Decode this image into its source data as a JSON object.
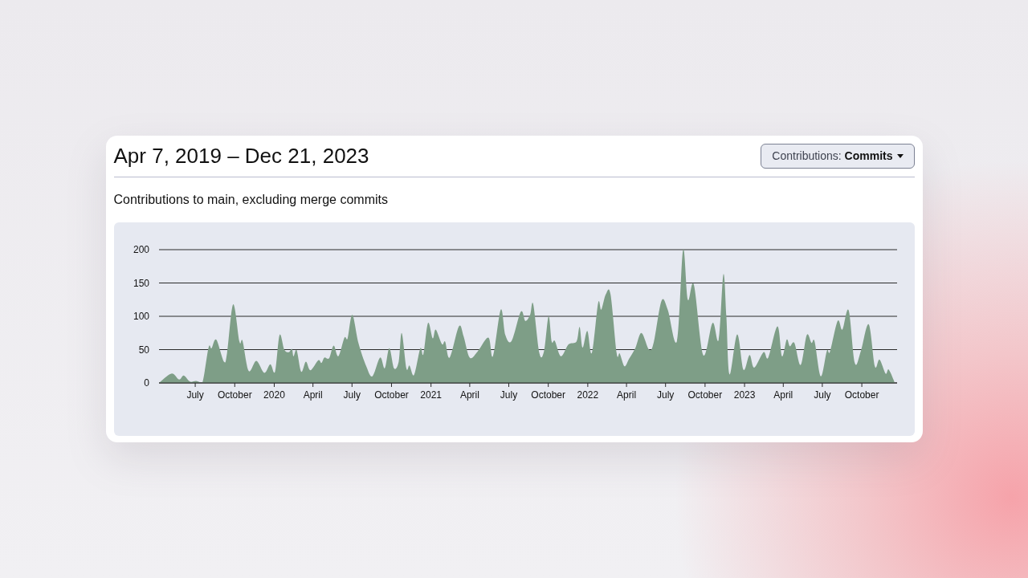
{
  "card": {
    "title": "Apr 7, 2019 – Dec 21, 2023",
    "menu_button": {
      "label": "Contributions: **Commits**"
    },
    "subtitle": "Contributions to main, excluding merge commits",
    "chart_data": {
      "type": "area",
      "grid": true,
      "xlim": [
        2019.265,
        2023.973
      ],
      "ylim": [
        0,
        200
      ],
      "yticks": [
        0,
        50,
        100,
        150,
        200
      ],
      "xticks": [
        {
          "value": 2019.496,
          "label": "July"
        },
        {
          "value": 2019.748,
          "label": "October"
        },
        {
          "value": 2020,
          "label": "2020"
        },
        {
          "value": 2020.247,
          "label": "April"
        },
        {
          "value": 2020.496,
          "label": "July"
        },
        {
          "value": 2020.748,
          "label": "October"
        },
        {
          "value": 2021,
          "label": "2021"
        },
        {
          "value": 2021.247,
          "label": "April"
        },
        {
          "value": 2021.496,
          "label": "July"
        },
        {
          "value": 2021.748,
          "label": "October"
        },
        {
          "value": 2022,
          "label": "2022"
        },
        {
          "value": 2022.247,
          "label": "April"
        },
        {
          "value": 2022.496,
          "label": "July"
        },
        {
          "value": 2022.748,
          "label": "October"
        },
        {
          "value": 2023,
          "label": "2023"
        },
        {
          "value": 2023.247,
          "label": "April"
        },
        {
          "value": 2023.496,
          "label": "July"
        },
        {
          "value": 2023.748,
          "label": "October"
        }
      ],
      "x": [
        2019.265,
        2019.344,
        2019.393,
        2019.423,
        2019.462,
        2019.502,
        2019.541,
        2019.581,
        2019.6,
        2019.63,
        2019.679,
        2019.699,
        2019.738,
        2019.778,
        2019.798,
        2019.837,
        2019.886,
        2019.936,
        2019.975,
        2020.005,
        2020.034,
        2020.064,
        2020.093,
        2020.113,
        2020.123,
        2020.143,
        2020.172,
        2020.202,
        2020.231,
        2020.281,
        2020.301,
        2020.32,
        2020.35,
        2020.379,
        2020.409,
        2020.448,
        2020.468,
        2020.498,
        2020.537,
        2020.587,
        2020.626,
        2020.675,
        2020.705,
        2020.734,
        2020.764,
        2020.794,
        2020.813,
        2020.843,
        2020.863,
        2020.892,
        2020.932,
        2020.951,
        2020.981,
        2021.011,
        2021.03,
        2021.07,
        2021.09,
        2021.119,
        2021.178,
        2021.208,
        2021.247,
        2021.297,
        2021.366,
        2021.395,
        2021.445,
        2021.474,
        2021.514,
        2021.573,
        2021.602,
        2021.632,
        2021.652,
        2021.691,
        2021.721,
        2021.75,
        2021.77,
        2021.79,
        2021.829,
        2021.878,
        2021.928,
        2021.948,
        2021.967,
        2021.997,
        2022.026,
        2022.066,
        2022.086,
        2022.115,
        2022.145,
        2022.184,
        2022.204,
        2022.234,
        2022.263,
        2022.303,
        2022.342,
        2022.391,
        2022.421,
        2022.47,
        2022.51,
        2022.569,
        2022.608,
        2022.638,
        2022.677,
        2022.736,
        2022.796,
        2022.835,
        2022.865,
        2022.884,
        2022.904,
        2022.953,
        2022.993,
        2023.032,
        2023.062,
        2023.121,
        2023.151,
        2023.21,
        2023.239,
        2023.269,
        2023.289,
        2023.318,
        2023.358,
        2023.397,
        2023.427,
        2023.447,
        2023.486,
        2023.525,
        2023.545,
        2023.594,
        2023.624,
        2023.664,
        2023.703,
        2023.742,
        2023.792,
        2023.831,
        2023.861,
        2023.9,
        2023.92,
        2023.959
      ],
      "series": [
        {
          "color": "#7e9e87",
          "values": [
            0,
            14,
            5,
            11,
            2,
            3,
            0,
            53,
            52,
            65,
            32,
            45,
            118,
            62,
            63,
            18,
            33,
            15,
            28,
            17,
            72,
            50,
            46,
            51,
            40,
            49,
            17,
            32,
            19,
            34,
            30,
            38,
            37,
            56,
            40,
            68,
            67,
            102,
            60,
            25,
            10,
            38,
            22,
            52,
            22,
            32,
            75,
            22,
            26,
            12,
            52,
            43,
            90,
            67,
            80,
            58,
            62,
            38,
            85,
            70,
            38,
            47,
            68,
            40,
            110,
            72,
            63,
            107,
            93,
            102,
            118,
            45,
            48,
            100,
            62,
            63,
            40,
            58,
            62,
            84,
            53,
            78,
            45,
            120,
            110,
            133,
            133,
            45,
            44,
            25,
            36,
            52,
            75,
            50,
            61,
            123,
            110,
            63,
            200,
            125,
            147,
            42,
            90,
            65,
            163,
            100,
            13,
            73,
            20,
            42,
            23,
            46,
            38,
            85,
            40,
            65,
            55,
            60,
            27,
            72,
            60,
            62,
            10,
            48,
            47,
            93,
            80,
            109,
            30,
            48,
            88,
            25,
            35,
            14,
            20,
            0
          ]
        }
      ]
    }
  }
}
